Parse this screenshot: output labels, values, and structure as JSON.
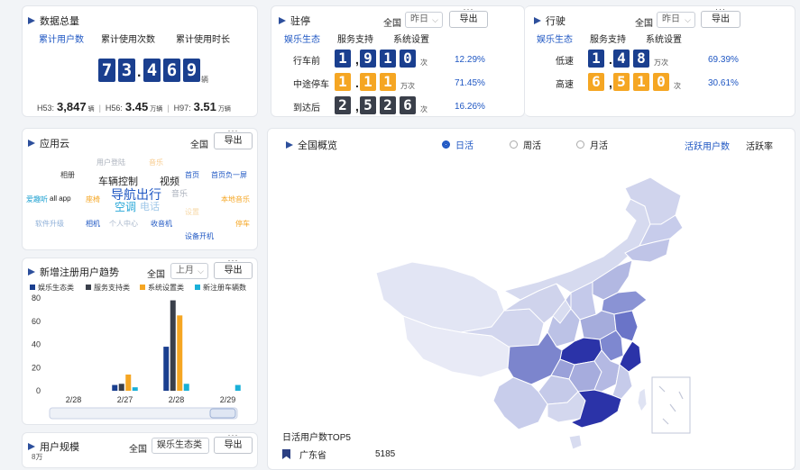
{
  "colors": {
    "navy": "#1a3f8f",
    "dark": "#3a3f4a",
    "orange": "#f5a623",
    "cyan": "#1ab0d8",
    "map_dark": "#2b33a8",
    "map_light": "#dfe3f3"
  },
  "total": {
    "title": "数据总量",
    "tabs": [
      "累计用户数",
      "累计使用次数",
      "累计使用时长"
    ],
    "digits": [
      "7",
      "3",
      ".",
      "4",
      "6",
      "9"
    ],
    "unit": "辆",
    "stats": [
      {
        "label": "H53:",
        "value": "3,847",
        "unit": "辆"
      },
      {
        "label": "H56:",
        "value": "3.45",
        "unit": "万辆"
      },
      {
        "label": "H97:",
        "value": "3.51",
        "unit": "万辆"
      }
    ]
  },
  "parking": {
    "title": "驻停",
    "region": "全国",
    "period": "昨日",
    "export": "导出",
    "tabs": [
      "娱乐生态",
      "服务支持",
      "系统设置"
    ],
    "rows": [
      {
        "label": "行车前",
        "digits": [
          "1",
          ",",
          "9",
          "1",
          "0"
        ],
        "style": "navy",
        "unit": "次",
        "pct": "12.29%"
      },
      {
        "label": "中途停车",
        "digits": [
          "1",
          ".",
          "1",
          "1"
        ],
        "style": "orange",
        "unit": "万次",
        "pct": "71.45%"
      },
      {
        "label": "到达后",
        "digits": [
          "2",
          ",",
          "5",
          "2",
          "6"
        ],
        "style": "dark",
        "unit": "次",
        "pct": "16.26%"
      }
    ]
  },
  "driving": {
    "title": "行驶",
    "region": "全国",
    "period": "昨日",
    "export": "导出",
    "tabs": [
      "娱乐生态",
      "服务支持",
      "系统设置"
    ],
    "rows": [
      {
        "label": "低速",
        "digits": [
          "1",
          ".",
          "4",
          "8"
        ],
        "style": "navy",
        "unit": "万次",
        "pct": "69.39%"
      },
      {
        "label": "高速",
        "digits": [
          "6",
          ",",
          "5",
          "1",
          "0"
        ],
        "style": "orange",
        "unit": "次",
        "pct": "30.61%"
      }
    ]
  },
  "app_cloud": {
    "title": "应用云",
    "region": "全国",
    "export": "导出",
    "words": [
      {
        "text": "用户登陆",
        "color": "#aab0bb",
        "size": 8
      },
      {
        "text": "音乐",
        "color": "#f7c98a",
        "size": 8
      },
      {
        "text": "相册",
        "color": "#333",
        "size": 8
      },
      {
        "text": "车辆控制",
        "color": "#222",
        "size": 11
      },
      {
        "text": "视频",
        "color": "#222",
        "size": 11
      },
      {
        "text": "首页",
        "color": "#1f57c3",
        "size": 8
      },
      {
        "text": "首页负一屏",
        "color": "#1f57c3",
        "size": 8
      },
      {
        "text": "爱趣听",
        "color": "#1a9fd0",
        "size": 8
      },
      {
        "text": "all app",
        "color": "#222",
        "size": 8
      },
      {
        "text": "座椅",
        "color": "#f5a623",
        "size": 8
      },
      {
        "text": "导航出行",
        "color": "#1f57c3",
        "size": 14
      },
      {
        "text": "音乐",
        "color": "#aab0bb",
        "size": 9
      },
      {
        "text": "本地音乐",
        "color": "#f5a623",
        "size": 8
      },
      {
        "text": "空调",
        "color": "#2aa8d8",
        "size": 12
      },
      {
        "text": "电话",
        "color": "#9fc7e8",
        "size": 11
      },
      {
        "text": "设置",
        "color": "#f7d9a8",
        "size": 8
      },
      {
        "text": "软件升级",
        "color": "#8fb0d8",
        "size": 8
      },
      {
        "text": "相机",
        "color": "#1f57c3",
        "size": 8
      },
      {
        "text": "个人中心",
        "color": "#aab8cc",
        "size": 8
      },
      {
        "text": "收音机",
        "color": "#1f57c3",
        "size": 8
      },
      {
        "text": "停车",
        "color": "#f5a623",
        "size": 8
      },
      {
        "text": "设备开机",
        "color": "#1f57c3",
        "size": 8
      }
    ]
  },
  "trend": {
    "title": "新增注册用户趋势",
    "region": "全国",
    "period": "上月",
    "export": "导出"
  },
  "chart_data": {
    "type": "bar",
    "categories": [
      "2/28",
      "2/27",
      "2/28",
      "2/29"
    ],
    "series": [
      {
        "name": "娱乐生态类",
        "color": "#1a3f8f",
        "values": [
          0,
          5,
          38,
          0
        ]
      },
      {
        "name": "服务支持类",
        "color": "#3a3f4a",
        "values": [
          0,
          6,
          78,
          0
        ]
      },
      {
        "name": "系统设置类",
        "color": "#f5a623",
        "values": [
          0,
          14,
          65,
          0
        ]
      },
      {
        "name": "新注册车辆数",
        "color": "#1ab0d8",
        "values": [
          0,
          3,
          6,
          5
        ]
      }
    ],
    "yticks": [
      "0",
      "20",
      "40",
      "60",
      "80"
    ],
    "ylim": [
      0,
      80
    ],
    "legend": "top-left"
  },
  "user_scale": {
    "title": "用户规模",
    "region": "全国",
    "category": "娱乐生态类",
    "export": "导出",
    "axis_top": "8万"
  },
  "overview": {
    "title": "全国概览",
    "radios": [
      {
        "label": "日活",
        "checked": true
      },
      {
        "label": "周活",
        "checked": false
      },
      {
        "label": "月活",
        "checked": false
      }
    ],
    "links": [
      "活跃用户数",
      "活跃率"
    ],
    "top5_title": "日活用户数TOP5",
    "top5": [
      {
        "name": "广东省",
        "value": "5185"
      }
    ]
  }
}
